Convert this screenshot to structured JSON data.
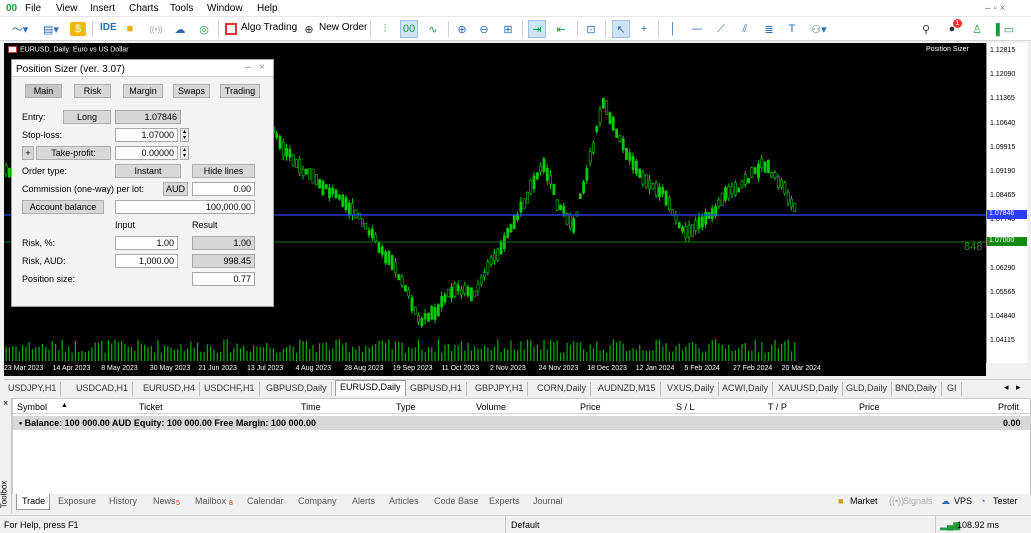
{
  "menu": {
    "logo": "00",
    "items": [
      "File",
      "View",
      "Insert",
      "Charts",
      "Tools",
      "Window",
      "Help"
    ],
    "window_controls": "– ▫ ×"
  },
  "toolbar": {
    "ide_label": "IDE",
    "algo_label": "Algo Trading",
    "new_order_label": "New Order",
    "period_label": "00",
    "notif_count": "1"
  },
  "chart": {
    "title": "EURUSD, Daily:  Euro vs US Dollar",
    "indicator_label": "Position Sizer",
    "side_number": "848",
    "price_ticks": [
      "1.12815",
      "1.12090",
      "1.11365",
      "1.10640",
      "1.09915",
      "1.09190",
      "1.08465",
      "1.07740",
      "1.07015",
      "1.06290",
      "1.05565",
      "1.04840",
      "1.04115"
    ],
    "date_ticks": [
      "23 Mar 2023",
      "14 Apr 2023",
      "8 May 2023",
      "30 May 2023",
      "21 Jun 2023",
      "13 Jul 2023",
      "4 Aug 2023",
      "28 Aug 2023",
      "19 Sep 2023",
      "11 Oct 2023",
      "2 Nov 2023",
      "24 Nov 2023",
      "18 Dec 2023",
      "12 Jan 2024",
      "5 Feb 2024",
      "27 Feb 2024",
      "20 Mar 2024"
    ],
    "current_price_label": "1.07846",
    "stop_price_label": "1.07000",
    "candle_color": "#00cc00",
    "volume_color": "#00b000"
  },
  "position_sizer": {
    "title": "Position Sizer (ver. 3.07)",
    "tabs": [
      "Main",
      "Risk",
      "Margin",
      "Swaps",
      "Trading"
    ],
    "entry_label": "Entry:",
    "entry_button": "Long",
    "entry_value": "1.07846",
    "sl_label": "Stop-loss:",
    "sl_value": "1.07000",
    "tp_plus": "+",
    "tp_label": "Take-profit:",
    "tp_value": "0.00000",
    "order_type_label": "Order type:",
    "order_type_value": "Instant",
    "hide_lines": "Hide lines",
    "commission_label": "Commission (one-way) per lot:",
    "commission_currency": "AUD",
    "commission_value": "0.00",
    "balance_button": "Account balance",
    "balance_value": "100,000.00",
    "col_input": "Input",
    "col_result": "Result",
    "risk_pct_label": "Risk, %:",
    "risk_pct_input": "1.00",
    "risk_pct_result": "1.00",
    "risk_aud_label": "Risk, AUD:",
    "risk_aud_input": "1,000.00",
    "risk_aud_result": "998.45",
    "pos_size_label": "Position size:",
    "pos_size_value": "0.77"
  },
  "chart_tabs": [
    "USDJPY,H1",
    "USDCAD,H1",
    "EURUSD,H4",
    "USDCHF,H1",
    "GBPUSD,Daily",
    "EURUSD,Daily",
    "GBPUSD,H1",
    "GBPJPY,H1",
    "CORN,Daily",
    "AUDNZD,M15",
    "VXUS,Daily",
    "ACWI,Daily",
    "XAUUSD,Daily",
    "GLD,Daily",
    "BND,Daily",
    "GI"
  ],
  "active_chart_tab": "EURUSD,Daily",
  "terminal": {
    "columns": [
      "Symbol",
      "Ticket",
      "Time",
      "Type",
      "Volume",
      "Price",
      "S / L",
      "T / P",
      "Price",
      "Profit"
    ],
    "balance_row": "Balance: 100 000.00 AUD  Equity: 100 000.00  Free Margin: 100 000.00",
    "balance_profit": "0.00",
    "tabs": [
      "Trade",
      "Exposure",
      "History",
      "News",
      "Mailbox",
      "Calendar",
      "Company",
      "Alerts",
      "Articles",
      "Code Base",
      "Experts",
      "Journal"
    ],
    "news_count": "5",
    "mailbox_count": "8",
    "market_label": "Market",
    "signals_label": "Signals",
    "vps_label": "VPS",
    "tester_label": "Tester",
    "toolbox_label": "Toolbox"
  },
  "status": {
    "help": "For Help, press F1",
    "profile": "Default",
    "ping": "108.92 ms"
  }
}
